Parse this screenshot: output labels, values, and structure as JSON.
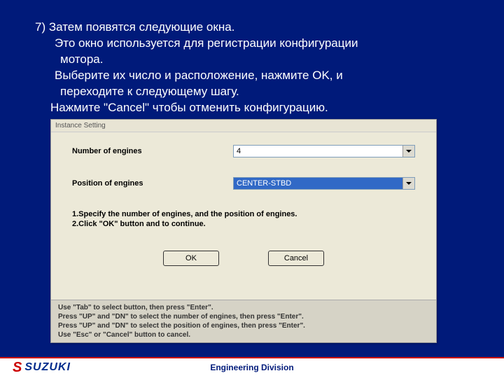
{
  "step": {
    "number": "7)",
    "line1": "Затем появятся следующие окна.",
    "line2": "Это окно используется для регистрации конфигурации",
    "line3": "мотора.",
    "line4": "Выберите их число и расположение, нажмите OK, и",
    "line5": "переходите к следующему шагу.",
    "line6": "Нажмите \"Cancel\" чтобы отменить конфигурацию."
  },
  "dialog": {
    "title": "Instance Setting",
    "fields": {
      "engines_label": "Number of engines",
      "engines_value": "4",
      "position_label": "Position of engines",
      "position_value": "CENTER-STBD"
    },
    "instructions": {
      "l1": "1.Specify the number of engines, and the position of engines.",
      "l2": "2.Click \"OK\" button and to continue."
    },
    "buttons": {
      "ok": "OK",
      "cancel": "Cancel"
    },
    "hints": {
      "h1": "Use \"Tab\" to select button, then press \"Enter\".",
      "h2": "Press \"UP\" and \"DN\" to select the number of engines, then press \"Enter\".",
      "h3": "Press \"UP\" and \"DN\" to select the position of engines, then press \"Enter\".",
      "h4": "Use \"Esc\" or \"Cancel\" button to cancel."
    }
  },
  "footer": {
    "brand": "SUZUKI",
    "caption": "Engineering Division"
  }
}
